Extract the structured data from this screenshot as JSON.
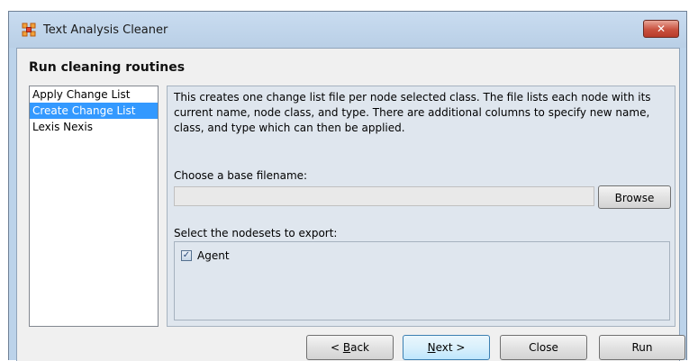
{
  "window": {
    "title": "Text Analysis Cleaner",
    "close_glyph": "✕",
    "app_icon": "network-nodes-icon",
    "accent_color": "#3399ff"
  },
  "heading": "Run cleaning routines",
  "routines": [
    {
      "label": "Apply Change List",
      "selected": false
    },
    {
      "label": "Create Change List",
      "selected": true
    },
    {
      "label": "Lexis Nexis",
      "selected": false
    }
  ],
  "panel": {
    "description": "This creates one change list file per node selected class. The file lists each node with its current name, node class, and type. There are additional columns to specify new name, class, and type which can then be applied.",
    "base_filename_label": "Choose a base filename:",
    "base_filename_value": "",
    "browse_label": "Browse",
    "nodesets_label": "Select the nodesets to export:",
    "nodesets": [
      {
        "label": "Agent",
        "checked": true
      }
    ]
  },
  "buttons": {
    "back": {
      "pre": "< ",
      "mnemonic": "B",
      "post": "ack"
    },
    "next": {
      "pre": "",
      "mnemonic": "N",
      "post": "ext >"
    },
    "close": "Close",
    "run": "Run"
  }
}
